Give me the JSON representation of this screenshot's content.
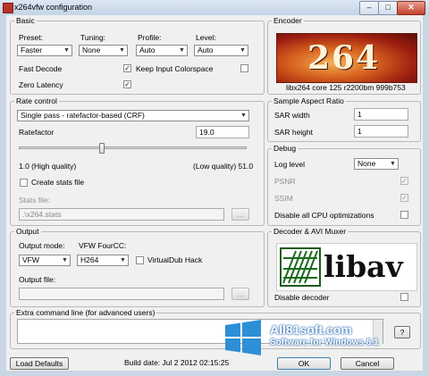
{
  "window": {
    "title": "x264vfw configuration",
    "minimize": "–",
    "restore": "□",
    "close": "✕"
  },
  "basic": {
    "legend": "Basic",
    "preset_label": "Preset:",
    "preset_value": "Faster",
    "tuning_label": "Tuning:",
    "tuning_value": "None",
    "profile_label": "Profile:",
    "profile_value": "Auto",
    "level_label": "Level:",
    "level_value": "Auto",
    "fast_decode_label": "Fast Decode",
    "fast_decode_checked": true,
    "zero_latency_label": "Zero Latency",
    "zero_latency_checked": true,
    "keep_colorspace_label": "Keep Input Colorspace",
    "keep_colorspace_checked": false
  },
  "encoder": {
    "legend": "Encoder",
    "logo_text": "264",
    "version": "libx264 core 125 r2200bm 999b753"
  },
  "rate_control": {
    "legend": "Rate control",
    "mode_value": "Single pass - ratefactor-based (CRF)",
    "ratefactor_label": "Ratefactor",
    "ratefactor_value": "19.0",
    "slider_fraction": 0.36,
    "min_label": "1.0 (High quality)",
    "max_label": "(Low quality) 51.0",
    "create_stats_label": "Create stats file",
    "create_stats_checked": false,
    "stats_file_label": "Stats file:",
    "stats_file_value": ".\\x264.stats",
    "browse_label": "..."
  },
  "sar": {
    "legend": "Sample Aspect Ratio",
    "width_label": "SAR width",
    "width_value": "1",
    "height_label": "SAR height",
    "height_value": "1"
  },
  "debug": {
    "legend": "Debug",
    "log_level_label": "Log level",
    "log_level_value": "None",
    "psnr_label": "PSNR",
    "psnr_checked": true,
    "ssim_label": "SSIM",
    "ssim_checked": true,
    "disable_cpu_label": "Disable all CPU optimizations",
    "disable_cpu_checked": false
  },
  "output": {
    "legend": "Output",
    "mode_label": "Output mode:",
    "mode_value": "VFW",
    "fourcc_label": "VFW FourCC:",
    "fourcc_value": "H264",
    "virtualdub_label": "VirtualDub Hack",
    "virtualdub_checked": false,
    "file_label": "Output file:",
    "file_value": "",
    "browse_label": "..."
  },
  "decoder": {
    "legend": "Decoder & AVI Muxer",
    "logo_text": "libav",
    "disable_decoder_label": "Disable decoder",
    "disable_decoder_checked": false
  },
  "extra": {
    "label": "Extra command line (for advanced users)",
    "help_label": "?"
  },
  "footer": {
    "load_defaults": "Load Defaults",
    "build_date": "Build date: Jul  2 2012 02:15:25",
    "ok": "OK",
    "cancel": "Cancel"
  },
  "watermark": {
    "site": "All81soft.com",
    "tagline": "Software for Windows 8.1"
  },
  "colors": {
    "titlebar": "#c9d6e3",
    "logo264": "#b3361a",
    "watermark_blue": "#2d6bb3"
  }
}
